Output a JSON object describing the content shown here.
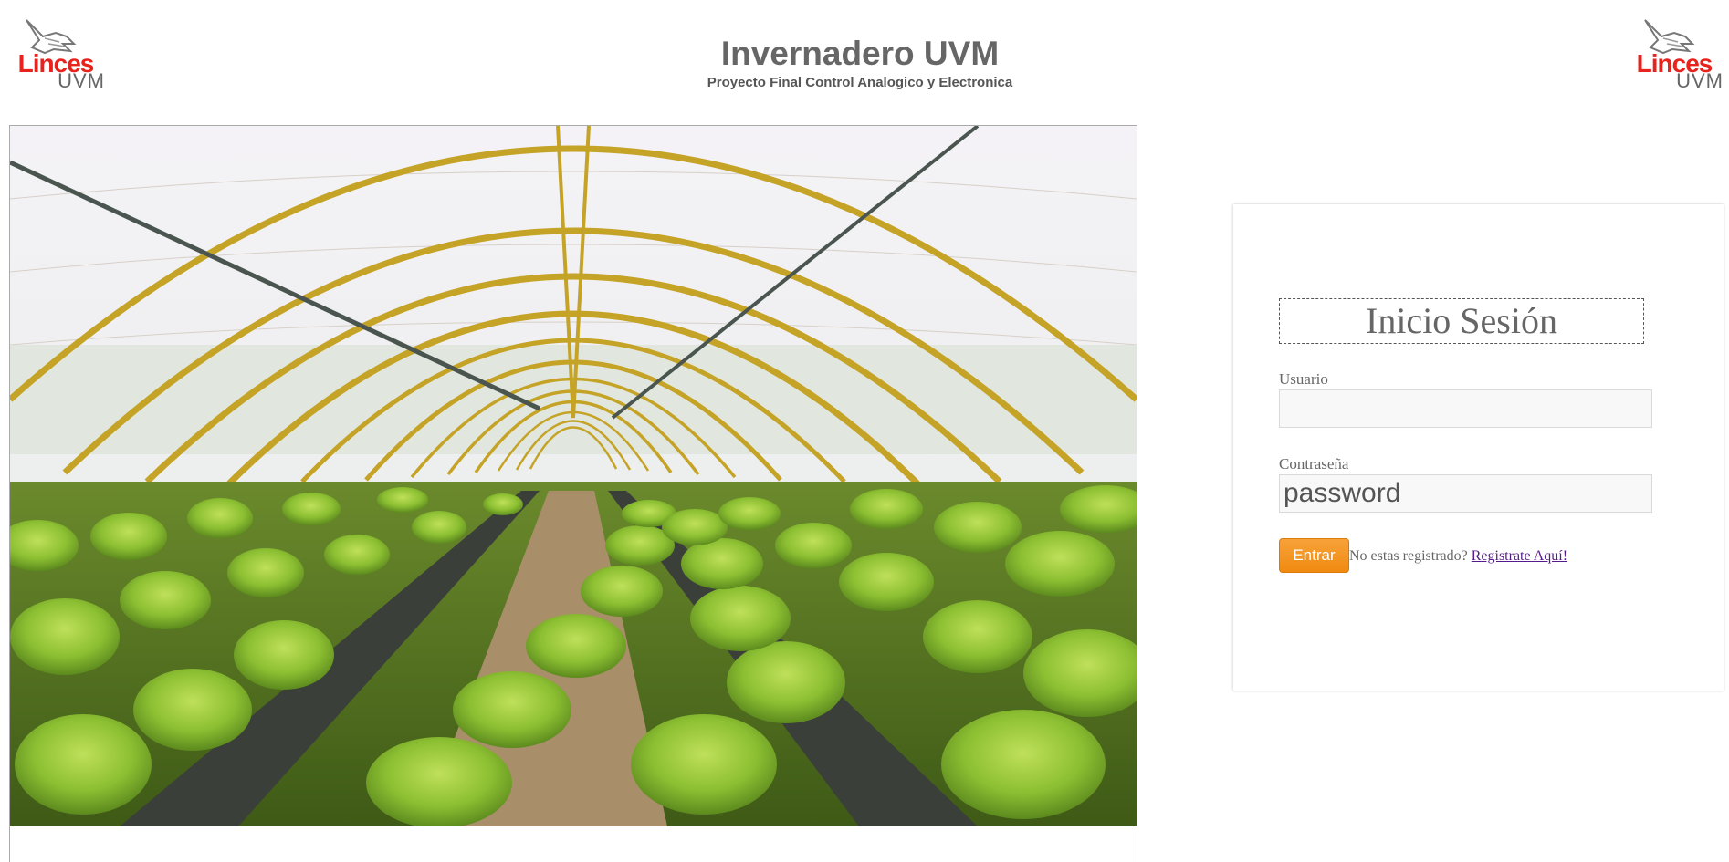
{
  "logos": {
    "brand": "Linces",
    "sub": "UVM",
    "brand_color": "#e8221c",
    "sub_color": "#666666"
  },
  "header": {
    "title": "Invernadero UVM",
    "subtitle": "Proyecto Final Control Analogico y Electronica"
  },
  "login": {
    "title": "Inicio Sesión",
    "username_label": "Usuario",
    "username_value": "",
    "password_label": "Contraseña",
    "password_value": "password",
    "submit_label": "Entrar",
    "register_prompt": "No estas registrado?",
    "register_link": "Registrate Aquí!",
    "accent_color": "#f08a10"
  }
}
